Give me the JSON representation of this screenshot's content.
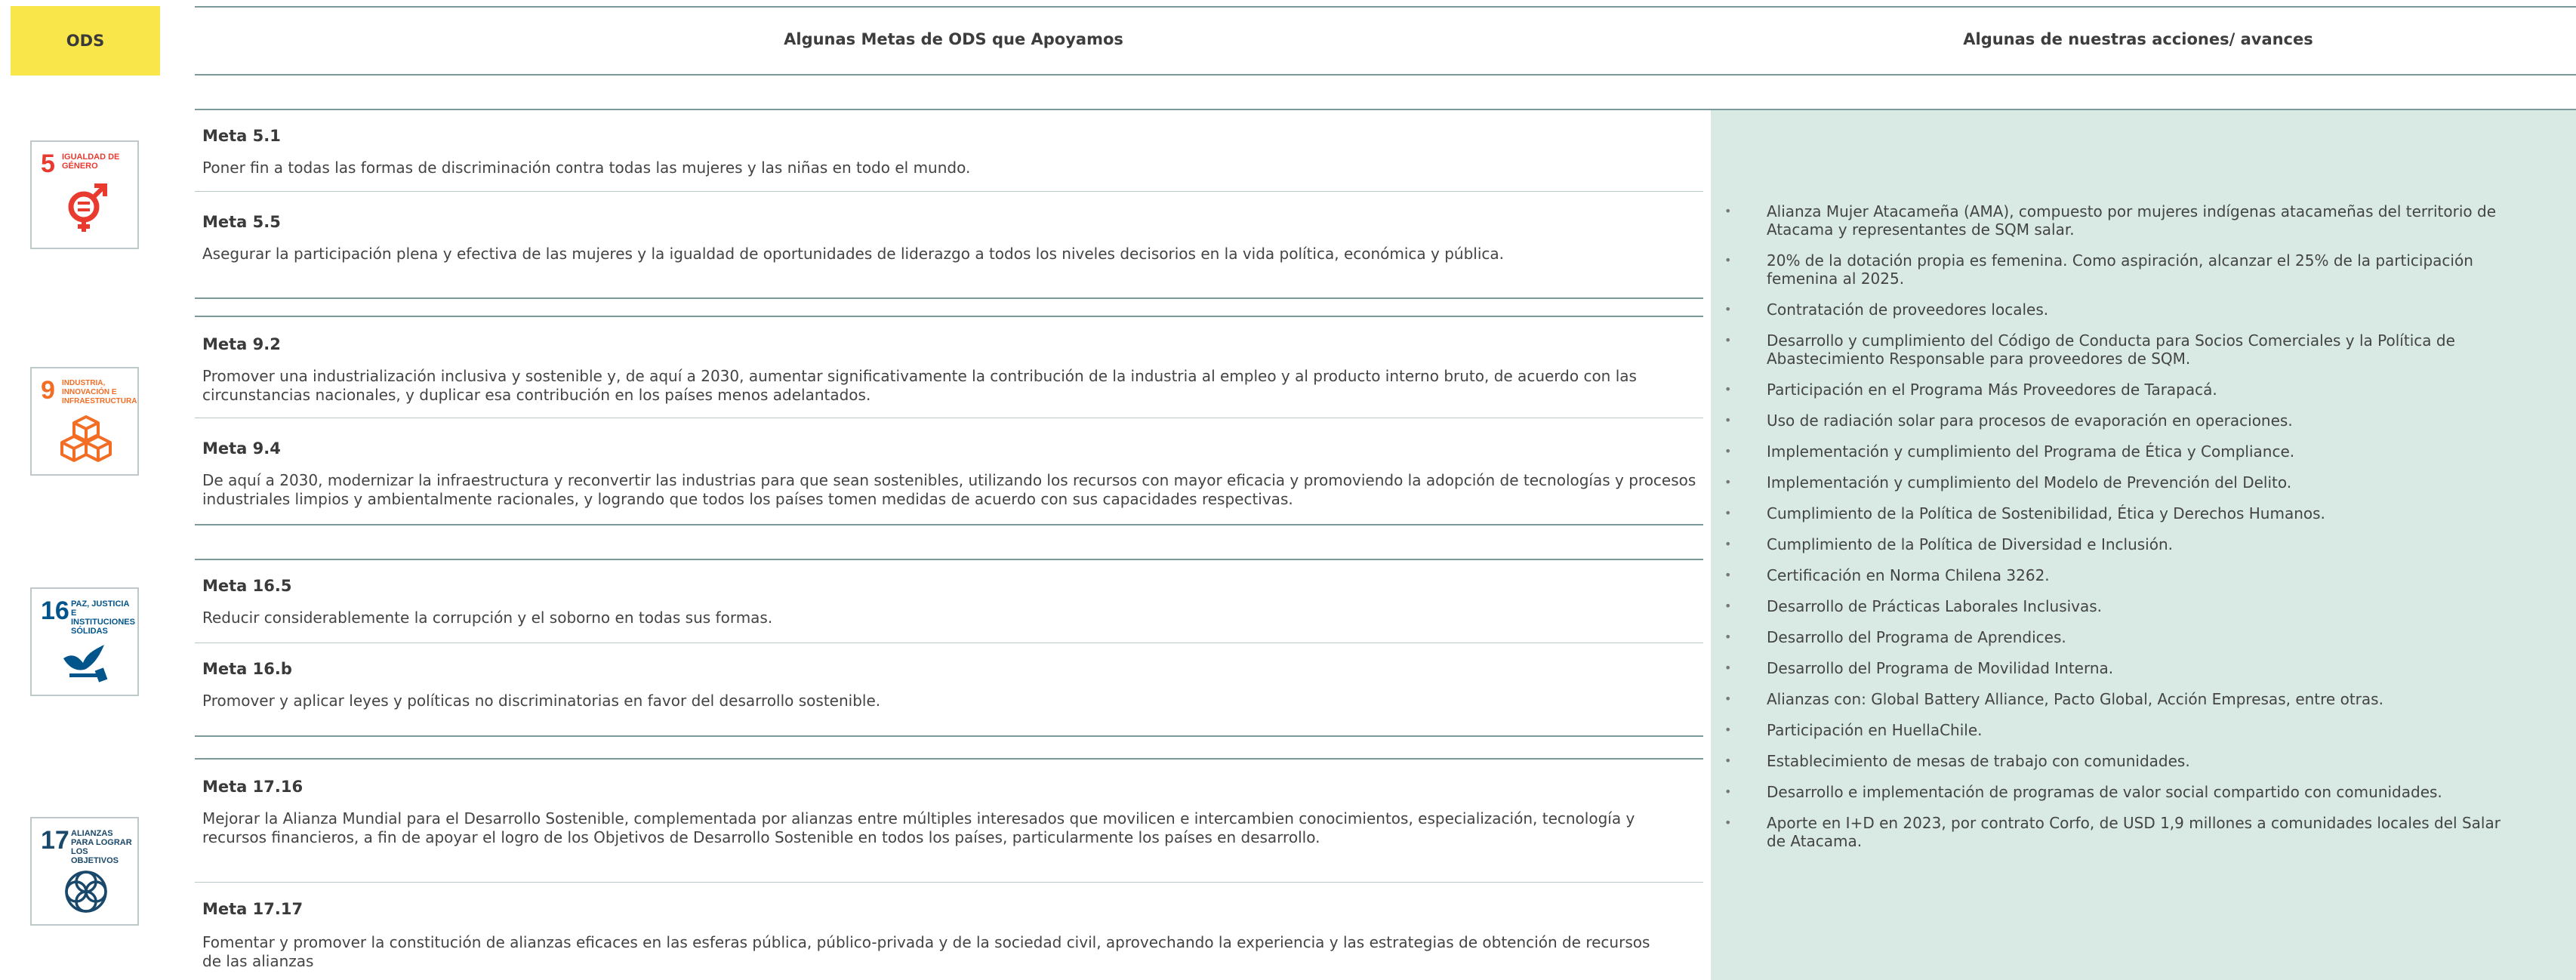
{
  "header": {
    "ods_label": "ODS",
    "metas_heading": "Algunas Metas de ODS que Apoyamos",
    "acciones_heading": "Algunas de nuestras acciones/ avances"
  },
  "colors": {
    "ods_header_bg": "#f8e64b",
    "actions_panel_bg": "#d9eae4",
    "sdg5": "#e83a2f",
    "sdg9": "#f36d25",
    "sdg16": "#02558b",
    "sdg17": "#19486a"
  },
  "sdg_icons": [
    {
      "number": "5",
      "label": "IGUALDAD DE GÉNERO",
      "icon": "gender-equality-icon"
    },
    {
      "number": "9",
      "label": "INDUSTRIA, INNOVACIÓN E INFRAESTRUCTURA",
      "icon": "industry-cubes-icon"
    },
    {
      "number": "16",
      "label": "PAZ, JUSTICIA E INSTITUCIONES SÓLIDAS",
      "icon": "dove-gavel-icon"
    },
    {
      "number": "17",
      "label": "ALIANZAS PARA LOGRAR LOS OBJETIVOS",
      "icon": "partnership-rings-icon"
    }
  ],
  "metas": [
    {
      "title": "Meta 5.1",
      "text": "Poner fin a todas las formas de discriminación contra todas las mujeres y las niñas en todo el mundo."
    },
    {
      "title": "Meta 5.5",
      "text": "Asegurar la participación plena y efectiva de las mujeres y la igualdad de oportunidades de liderazgo a todos los niveles decisorios en la vida política, económica y pública."
    },
    {
      "title": "Meta 9.2",
      "text": "Promover una industrialización inclusiva y sostenible y, de aquí a 2030, aumentar significativamente la contribución de la industria al empleo y al producto interno bruto, de acuerdo con las circunstancias nacionales, y duplicar esa contribución en los países menos adelantados."
    },
    {
      "title": "Meta 9.4",
      "text": "De aquí a 2030, modernizar la infraestructura y reconvertir las industrias para que sean sostenibles, utilizando los recursos con mayor eficacia y promoviendo la adopción de tecnologías y procesos industriales limpios y ambientalmente racionales, y logrando que todos los países tomen medidas de acuerdo con sus capacidades respectivas."
    },
    {
      "title": "Meta 16.5",
      "text": "Reducir considerablemente la corrupción y el soborno en todas sus formas."
    },
    {
      "title": "Meta 16.b",
      "text": "Promover y aplicar leyes y políticas no discriminatorias en favor del desarrollo sostenible."
    },
    {
      "title": "Meta 17.16",
      "text": "Mejorar la Alianza Mundial para el Desarrollo Sostenible, complementada por alianzas entre múltiples interesados que movilicen e intercambien conocimientos, especialización, tecnología y recursos financieros, a fin de apoyar el logro de los Objetivos de Desarrollo Sostenible en todos los países, particularmente los países en desarrollo."
    },
    {
      "title": "Meta 17.17",
      "text": "Fomentar y promover la constitución de alianzas eficaces en las esferas pública, público-privada y de la sociedad civil, aprovechando la experiencia y las estrategias de obtención de recursos de las alianzas"
    }
  ],
  "acciones": [
    "Alianza Mujer Atacameña (AMA), compuesto por mujeres indígenas atacameñas del territorio de Atacama y representantes de SQM salar.",
    "20% de la dotación propia es femenina. Como aspiración, alcanzar el 25% de la participación femenina al 2025.",
    "Contratación de proveedores locales.",
    "Desarrollo y cumplimiento del Código de Conducta para Socios Comerciales y la Política de Abastecimiento Responsable para proveedores de SQM.",
    "Participación en el Programa Más Proveedores de Tarapacá.",
    "Uso de radiación solar para procesos de evaporación en operaciones.",
    "Implementación y cumplimiento del Programa de Ética y Compliance.",
    "Implementación y cumplimiento del Modelo de Prevención del Delito.",
    "Cumplimiento de la Política de Sostenibilidad, Ética y Derechos Humanos.",
    "Cumplimiento de la Política de Diversidad e Inclusión.",
    "Certificación en Norma Chilena 3262.",
    "Desarrollo de Prácticas Laborales Inclusivas.",
    "Desarrollo del Programa de Aprendices.",
    "Desarrollo del Programa de Movilidad Interna.",
    "Alianzas con: Global Battery Alliance, Pacto Global, Acción Empresas, entre otras.",
    "Participación en HuellaChile.",
    "Establecimiento de mesas de trabajo con comunidades.",
    "Desarrollo e implementación de programas de valor social compartido con comunidades.",
    "Aporte en I+D en 2023, por contrato Corfo, de USD 1,9 millones a comunidades locales del Salar de Atacama."
  ]
}
